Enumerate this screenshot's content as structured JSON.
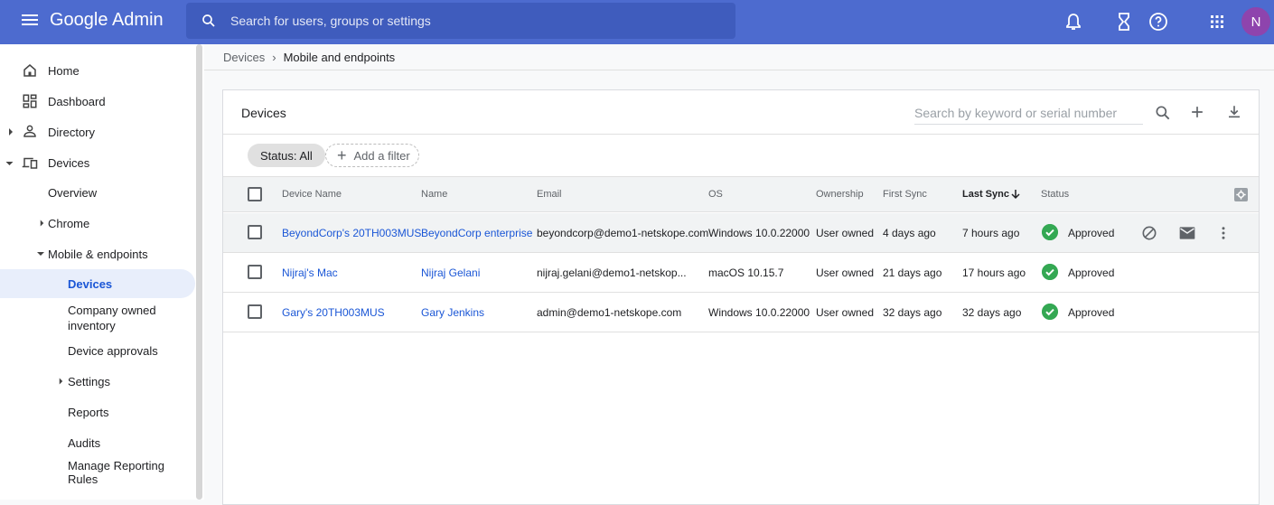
{
  "app": {
    "brand": "Google Admin"
  },
  "top_search": {
    "placeholder": "Search for users, groups or settings"
  },
  "top_icons": [
    "notifications-icon",
    "hourglass-icon",
    "help-icon",
    "apps-grid-icon"
  ],
  "avatar_initial": "N",
  "sidebar": {
    "items": [
      {
        "label": "Home",
        "icon": "home-icon"
      },
      {
        "label": "Dashboard",
        "icon": "dashboard-icon"
      },
      {
        "label": "Directory",
        "icon": "person-icon"
      },
      {
        "label": "Devices",
        "icon": "devices-icon"
      },
      {
        "label": "Overview"
      },
      {
        "label": "Chrome"
      },
      {
        "label": "Mobile & endpoints"
      },
      {
        "label": "Devices"
      },
      {
        "label": "Company owned inventory"
      },
      {
        "label": "Device approvals"
      },
      {
        "label": "Settings"
      },
      {
        "label": "Reports"
      },
      {
        "label": "Audits"
      },
      {
        "label": "Manage Reporting Rules"
      }
    ]
  },
  "breadcrumb": {
    "root": "Devices",
    "sep": "›",
    "current": "Mobile and endpoints"
  },
  "card": {
    "title": "Devices",
    "search_placeholder": "Search by keyword or serial number",
    "filter_chip": "Status: All",
    "add_filter": "Add a filter"
  },
  "table": {
    "columns": [
      "Device Name",
      "Name",
      "Email",
      "OS",
      "Ownership",
      "First Sync",
      "Last Sync",
      "Status"
    ],
    "sorted_column": "Last Sync",
    "rows": [
      {
        "device": "BeyondCorp's 20TH003MUS",
        "name": "BeyondCorp enterprise",
        "email": "beyondcorp@demo1-netskope.com",
        "os": "Windows 10.0.22000",
        "ownership": "User owned",
        "first_sync": "4 days ago",
        "last_sync": "7 hours ago",
        "status": "Approved"
      },
      {
        "device": "Nijraj's Mac",
        "name": "Nijraj Gelani",
        "email": "nijraj.gelani@demo1-netskop...",
        "os": "macOS 10.15.7",
        "ownership": "User owned",
        "first_sync": "21 days ago",
        "last_sync": "17 hours ago",
        "status": "Approved"
      },
      {
        "device": "Gary's 20TH003MUS",
        "name": "Gary Jenkins",
        "email": "admin@demo1-netskope.com",
        "os": "Windows 10.0.22000",
        "ownership": "User owned",
        "first_sync": "32 days ago",
        "last_sync": "32 days ago",
        "status": "Approved"
      }
    ]
  },
  "colors": {
    "topbar": "#4d6bcf",
    "link": "#1a56d6",
    "approved": "#34a853",
    "avatar": "#8e44ad"
  }
}
